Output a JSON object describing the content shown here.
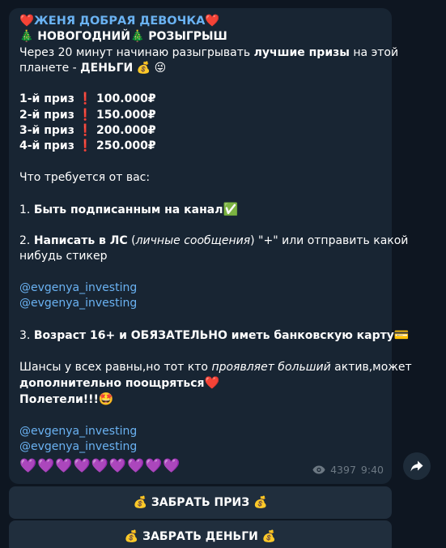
{
  "message": {
    "title": "❤️ЖЕНЯ ДОБРАЯ ДЕВОЧКА❤️",
    "subtitle": "🎄 НОВОГОДНИЙ🎄 РОЗЫГРЫШ",
    "intro_1_a": "Через 20 минут начинаю разыгрывать ",
    "intro_1_b": "лучшие призы",
    "intro_1_c": " на этой",
    "intro_2_a": "планете - ",
    "intro_2_b": "ДЕНЬГИ",
    "intro_2_c": " 💰 😜",
    "prizes": [
      "1-й приз ❗ 100.000₽",
      "2-й приз ❗ 150.000₽",
      "3-й приз ❗ 200.000₽",
      "4-й приз ❗ 250.000₽"
    ],
    "requirements_heading": "Что требуется от вас:",
    "req1_num": "1. ",
    "req1_text": "Быть подписанным на канал",
    "req1_emoji": "✅",
    "req2_num": "2. ",
    "req2_bold": "Написать в ЛС",
    "req2_open": " (",
    "req2_italic": "личные сообщения",
    "req2_rest": ") \"+\" или отправить какой",
    "req2_line2": "нибудь стикер",
    "link_1": "@evgenya_investing",
    "link_2": "@evgenya_investing",
    "req3_num": "3. ",
    "req3_text": "Возраст 16+ и ОБЯЗАТЕЛЬНО иметь банковскую карту",
    "req3_emoji": "💳",
    "chances_a": "Шансы у всех равны,но тот кто ",
    "chances_italic": "проявляет больший",
    "chances_b": " актив,может",
    "chances_line2": "дополнительно поощряться",
    "chances_emoji": "❤️",
    "fly_text": "Полетели!!!",
    "fly_emoji": "🤩",
    "link_3": "@evgenya_investing",
    "link_4": "@evgenya_investing",
    "hearts": "💜💜💜💜💜💜💜💜💜",
    "views": "4397",
    "time": "9:40"
  },
  "buttons": {
    "claim_prize": "💰 ЗАБРАТЬ ПРИЗ 💰",
    "claim_money": "💰 ЗАБРАТЬ ДЕНЬГИ 💰"
  },
  "icons": {
    "views": "eye-icon",
    "share": "share-arrow-icon"
  },
  "colors": {
    "background": "#0e1621",
    "bubble": "#182533",
    "link": "#6ab2f2",
    "meta": "#6c7883",
    "button": "#202e3d"
  }
}
